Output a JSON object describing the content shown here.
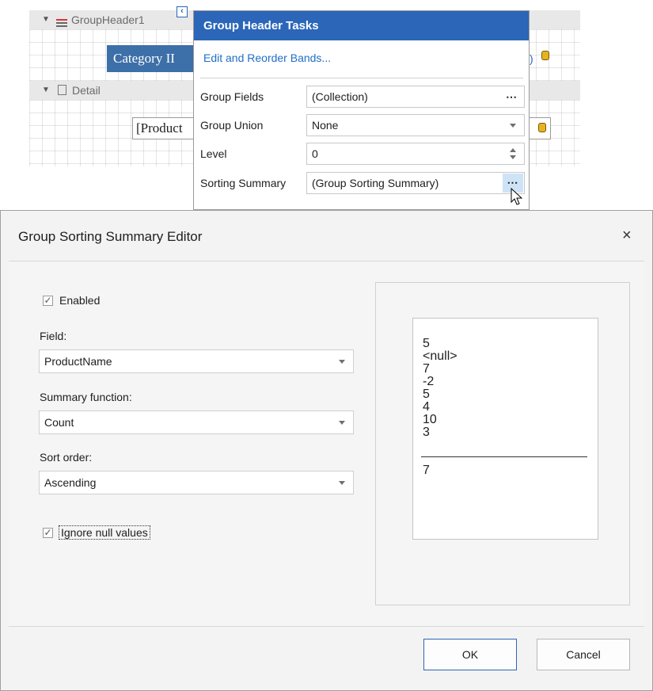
{
  "designer": {
    "group_header_band": "GroupHeader1",
    "detail_band": "Detail",
    "category_cell": "Category II",
    "product_cell": "[Product",
    "trailing_text": ")"
  },
  "tasks": {
    "title": "Group Header Tasks",
    "edit_link": "Edit and Reorder Bands...",
    "rows": [
      {
        "label": "Group Fields",
        "value": "(Collection)"
      },
      {
        "label": "Group Union",
        "value": "None"
      },
      {
        "label": "Level",
        "value": "0"
      },
      {
        "label": "Sorting Summary",
        "value": "(Group Sorting Summary)"
      }
    ],
    "ellipsis": "⋯"
  },
  "dialog": {
    "title": "Group Sorting Summary Editor",
    "close": "×",
    "enabled_label": "Enabled",
    "enabled_checked": true,
    "field_label": "Field:",
    "field_value": "ProductName",
    "function_label": "Summary function:",
    "function_value": "Count",
    "order_label": "Sort order:",
    "order_value": "Ascending",
    "ignore_null_label": "Ignore null values",
    "ignore_null_checked": true,
    "preview_values": [
      "5",
      "<null>",
      "7",
      "-2",
      "5",
      "4",
      "10",
      "3"
    ],
    "preview_result": "7",
    "ok_label": "OK",
    "cancel_label": "Cancel"
  },
  "colors": {
    "accent": "#2b66b8",
    "link": "#1f6fc8"
  }
}
